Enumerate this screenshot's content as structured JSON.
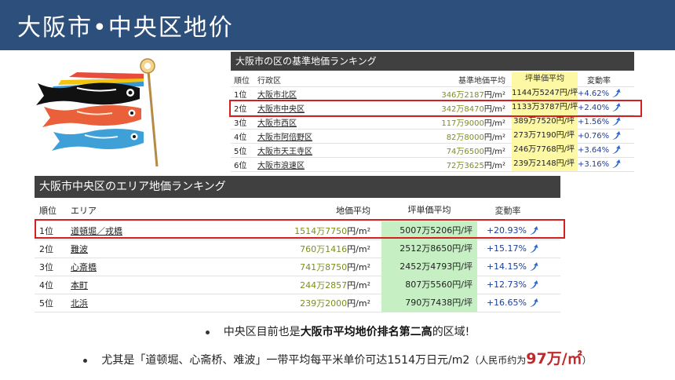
{
  "slide": {
    "title": "大阪市•中央区地价"
  },
  "table1": {
    "title": "大阪市の区の基準地価ランキング",
    "headers": {
      "rank": "順位",
      "name": "行政区",
      "price": "基準地価平均",
      "tsubo": "坪単価平均",
      "change": "変動率"
    },
    "rows": [
      {
        "rank": "1位",
        "name": "大阪市北区",
        "price": "346万2187",
        "price_unit": "円/m²",
        "tsubo": "1144万5247円/坪",
        "change": "+4.62%"
      },
      {
        "rank": "2位",
        "name": "大阪市中央区",
        "price": "342万8470",
        "price_unit": "円/m²",
        "tsubo": "1133万3787円/坪",
        "change": "+2.40%"
      },
      {
        "rank": "3位",
        "name": "大阪市西区",
        "price": "117万9000",
        "price_unit": "円/m²",
        "tsubo": "389万7520円/坪",
        "change": "+1.56%"
      },
      {
        "rank": "4位",
        "name": "大阪市阿倍野区",
        "price": "82万8000",
        "price_unit": "円/m²",
        "tsubo": "273万7190円/坪",
        "change": "+0.76%"
      },
      {
        "rank": "5位",
        "name": "大阪市天王寺区",
        "price": "74万6500",
        "price_unit": "円/m²",
        "tsubo": "246万7768円/坪",
        "change": "+3.64%"
      },
      {
        "rank": "6位",
        "name": "大阪市浪速区",
        "price": "72万3625",
        "price_unit": "円/m²",
        "tsubo": "239万2148円/坪",
        "change": "+3.16%"
      }
    ],
    "highlight_color": "#fdf8a4"
  },
  "table2": {
    "title": "大阪市中央区のエリア地価ランキング",
    "headers": {
      "rank": "順位",
      "area": "エリア",
      "price": "地価平均",
      "tsubo": "坪単価平均",
      "change": "変動率"
    },
    "rows": [
      {
        "rank": "1位",
        "area": "道頓堀／戎橋",
        "price": "1514万7750",
        "price_unit": "円/m²",
        "tsubo": "5007万5206円/坪",
        "change": "+20.93%"
      },
      {
        "rank": "2位",
        "area": "難波",
        "price": "760万1416",
        "price_unit": "円/m²",
        "tsubo": "2512万8650円/坪",
        "change": "+15.17%"
      },
      {
        "rank": "3位",
        "area": "心斎橋",
        "price": "741万8750",
        "price_unit": "円/m²",
        "tsubo": "2452万4793円/坪",
        "change": "+14.15%"
      },
      {
        "rank": "4位",
        "area": "本町",
        "price": "244万2857",
        "price_unit": "円/m²",
        "tsubo": "807万5560円/坪",
        "change": "+12.73%"
      },
      {
        "rank": "5位",
        "area": "北浜",
        "price": "239万2000",
        "price_unit": "円/m²",
        "tsubo": "790万7438円/坪",
        "change": "+16.65%"
      }
    ],
    "highlight_color": "#c6efc4"
  },
  "bullets": {
    "b1_pre": "中央区目前也是",
    "b1_bold": "大阪市平均地价排名第二高",
    "b1_post": "的区域!",
    "b2_pre": "尤其是「道顿堀、心斋桥、难波」一带平均每平米单价可达1514万日元/m2",
    "b2_paren_open": "（人民币约为",
    "b2_big": "97万/㎡",
    "b2_paren_close": "）"
  },
  "colors": {
    "title_bar": "#2d4f7c",
    "table_header": "#404040",
    "highlight_box": "#d32020",
    "price_text": "#7b8f1c",
    "change_text": "#1a3fa0"
  },
  "icons": {
    "decoration": "koinobori-carp-streamer",
    "trend": "up-arrow-icon"
  }
}
